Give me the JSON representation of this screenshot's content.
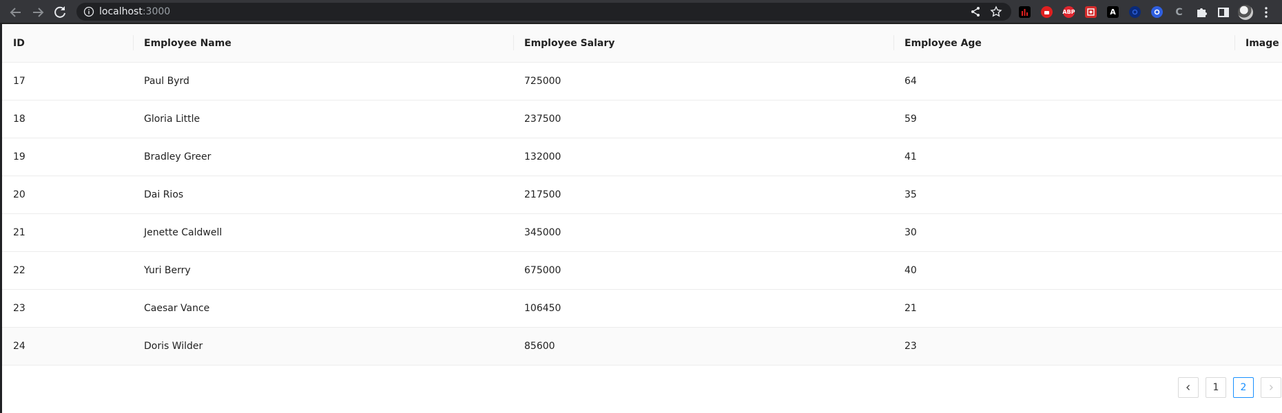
{
  "browser": {
    "url_host": "localhost",
    "url_port": ":3000",
    "icons": {
      "back": "arrow-left-icon",
      "forward": "arrow-right-icon",
      "reload": "reload-icon",
      "site_info": "info-icon",
      "share": "share-icon",
      "bookmark": "star-icon",
      "extensions": "puzzle-icon",
      "side_panel": "side-panel-icon",
      "menu": "kebab-menu-icon"
    },
    "extensions": [
      {
        "name": "ext-stats-icon",
        "text": "",
        "color": "#000000"
      },
      {
        "name": "ext-stop-icon",
        "text": "",
        "color": "#e02020"
      },
      {
        "name": "ext-adblock-icon",
        "text": "ABP",
        "color": "#e0262f"
      },
      {
        "name": "ext-red-box-icon",
        "text": "",
        "color": "#d32b2b"
      },
      {
        "name": "ext-angular-icon",
        "text": "A",
        "color": "#000000"
      },
      {
        "name": "ext-blue-circle-icon",
        "text": "",
        "color": "#0a2a7a"
      },
      {
        "name": "ext-target-icon",
        "text": "",
        "color": "#2f5fe0"
      },
      {
        "name": "ext-c-icon",
        "text": "C",
        "color": "#5f6368"
      }
    ]
  },
  "table": {
    "columns": [
      "ID",
      "Employee Name",
      "Employee Salary",
      "Employee Age",
      "Image"
    ],
    "rows": [
      [
        "17",
        "Paul Byrd",
        "725000",
        "64",
        ""
      ],
      [
        "18",
        "Gloria Little",
        "237500",
        "59",
        ""
      ],
      [
        "19",
        "Bradley Greer",
        "132000",
        "41",
        ""
      ],
      [
        "20",
        "Dai Rios",
        "217500",
        "35",
        ""
      ],
      [
        "21",
        "Jenette Caldwell",
        "345000",
        "30",
        ""
      ],
      [
        "22",
        "Yuri Berry",
        "675000",
        "40",
        ""
      ],
      [
        "23",
        "Caesar Vance",
        "106450",
        "21",
        ""
      ],
      [
        "24",
        "Doris Wilder",
        "85600",
        "23",
        ""
      ]
    ]
  },
  "pagination": {
    "prev_icon": "chevron-left-icon",
    "next_icon": "chevron-right-icon",
    "pages": [
      "1",
      "2"
    ],
    "current": "2",
    "accent": "#1890ff"
  }
}
